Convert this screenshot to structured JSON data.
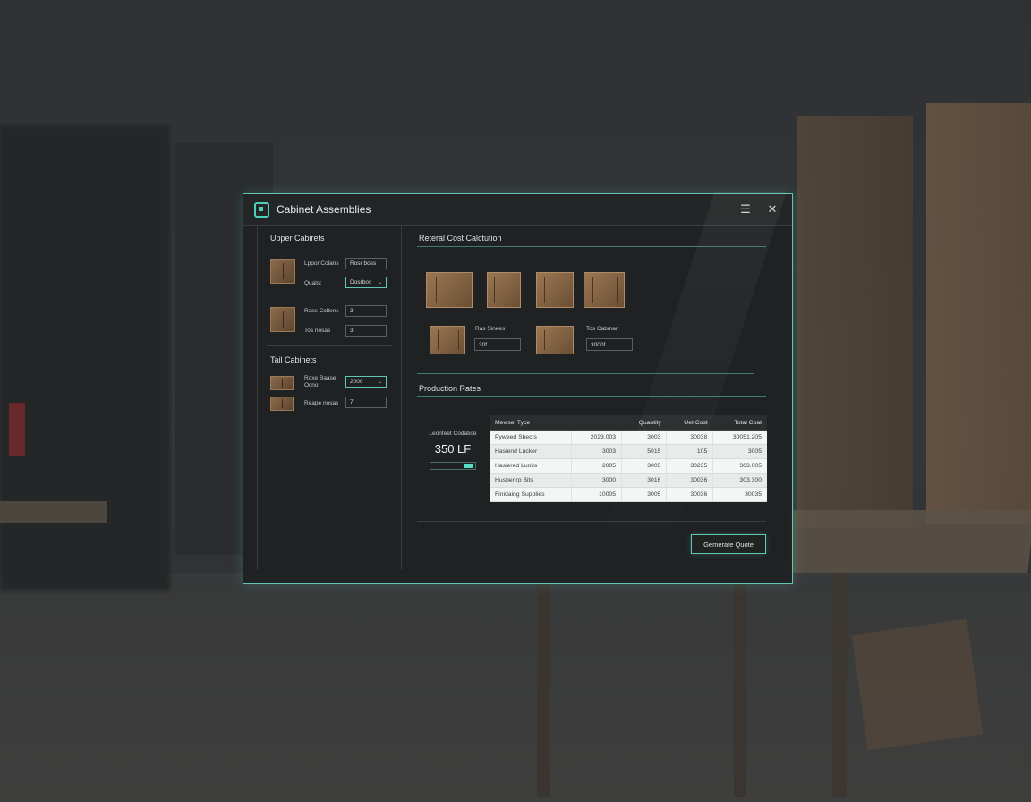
{
  "window": {
    "title": "Cabinet Assemblies",
    "menu_icon": "hamburger-icon",
    "close_icon": "close-icon",
    "accent": "#5fc7b4"
  },
  "left": {
    "upper_title": "Upper Cabirets",
    "upper_rows": [
      {
        "label": "Lppor Colans",
        "value": "Rosr boss"
      },
      {
        "label": "Qualst",
        "value": "Dosrbos"
      }
    ],
    "upper_rows2": [
      {
        "label": "Rass Coltens",
        "value": "3"
      },
      {
        "label": "Tos nosas",
        "value": "3"
      }
    ],
    "tall_title": "Tail Cabinets",
    "tall_rows": [
      {
        "label": "Roxe Baase Ocno",
        "value": "2000"
      },
      {
        "label": "Reape nosas",
        "value": "7"
      }
    ]
  },
  "right": {
    "calc_title": "Reteral Cost Calctution",
    "calc_fields": [
      {
        "label": "Ras Sinees",
        "value": "30f"
      },
      {
        "label": "Tos Cabman",
        "value": "3000f"
      }
    ],
    "rates_title": "Production Rates",
    "lf_label": "Leonfeet Codatioe",
    "lf_value": "350 LF",
    "lf_progress": 0.85,
    "table": {
      "headers": [
        "Mewsel Tyce",
        "Quantity",
        "Uet Cost",
        "Total Coat"
      ],
      "rows": [
        [
          "Pyweed Shects",
          "2023.003",
          "3003",
          "30038",
          "30051.205"
        ],
        [
          "Hasiend Lucker",
          "3003",
          "5015",
          "105",
          "3005"
        ],
        [
          "Hasiered Lunits",
          "2005",
          "3005",
          "30235",
          "303.005"
        ],
        [
          "Husbenrp Bits",
          "3000",
          "3016",
          "30036",
          "303.300"
        ],
        [
          "Finidaing Supplies",
          "10005",
          "3005",
          "30036",
          "30035"
        ]
      ]
    },
    "quote_button": "Gemerate Quote"
  }
}
